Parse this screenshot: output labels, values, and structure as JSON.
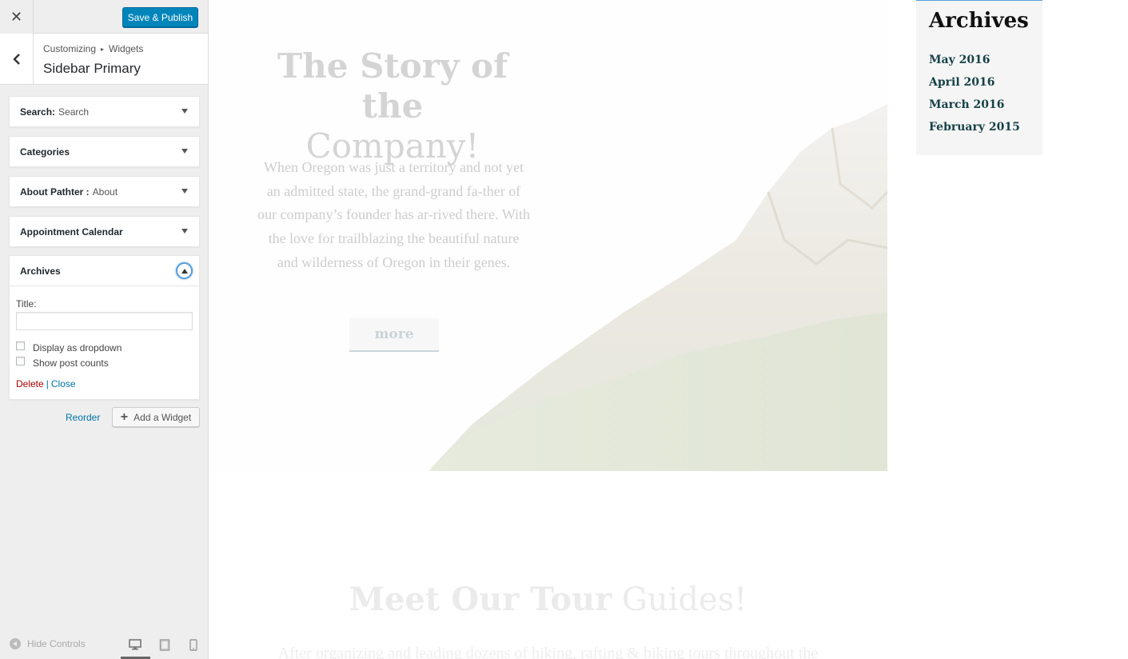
{
  "header": {
    "close_label": "✕",
    "publish_label": "Save & Publish"
  },
  "section": {
    "breadcrumb_parent": "Customizing",
    "breadcrumb_separator": "▸",
    "breadcrumb_current": "Widgets",
    "title": "Sidebar Primary"
  },
  "widgets": [
    {
      "name": "Search:",
      "sub": "Search",
      "expanded": false
    },
    {
      "name": "Categories",
      "sub": "",
      "expanded": false
    },
    {
      "name": "About Pathter :",
      "sub": "About",
      "expanded": false
    },
    {
      "name": "Appointment Calendar",
      "sub": "",
      "expanded": false
    },
    {
      "name": "Archives",
      "sub": "",
      "expanded": true
    }
  ],
  "archives_form": {
    "title_label": "Title:",
    "title_value": "",
    "dropdown_label": "Display as dropdown",
    "dropdown_checked": false,
    "counts_label": "Show post counts",
    "counts_checked": false,
    "delete_label": "Delete",
    "separator": "|",
    "close_label": "Close"
  },
  "actions": {
    "reorder_label": "Reorder",
    "add_widget_label": "Add a Widget"
  },
  "footer": {
    "hide_controls_label": "Hide Controls",
    "active_device": "desktop"
  },
  "preview": {
    "story_title_bold": "The Story of the",
    "story_title_light": "Company!",
    "story_text": "When Oregon was just a territory and not yet an admitted state, the grand-grand fa-ther of our company’s founder has ar-rived there. With the love for trailblazing the beautiful nature and wilderness of Oregon in their genes.",
    "more_label": "more",
    "archives_widget_title": "Archives",
    "archive_links": [
      "May 2016",
      "April 2016",
      "March 2016",
      "February 2015"
    ],
    "guides_title_bold": "Meet Our Tour",
    "guides_title_light": "Guides!",
    "guides_text": "After organizing and leading dozens of hiking, rafting & biking tours throughout the"
  },
  "colors": {
    "primary_button": "#0085ba",
    "link": "#0073aa",
    "delete": "#aa0000",
    "archive_link": "#164148"
  }
}
